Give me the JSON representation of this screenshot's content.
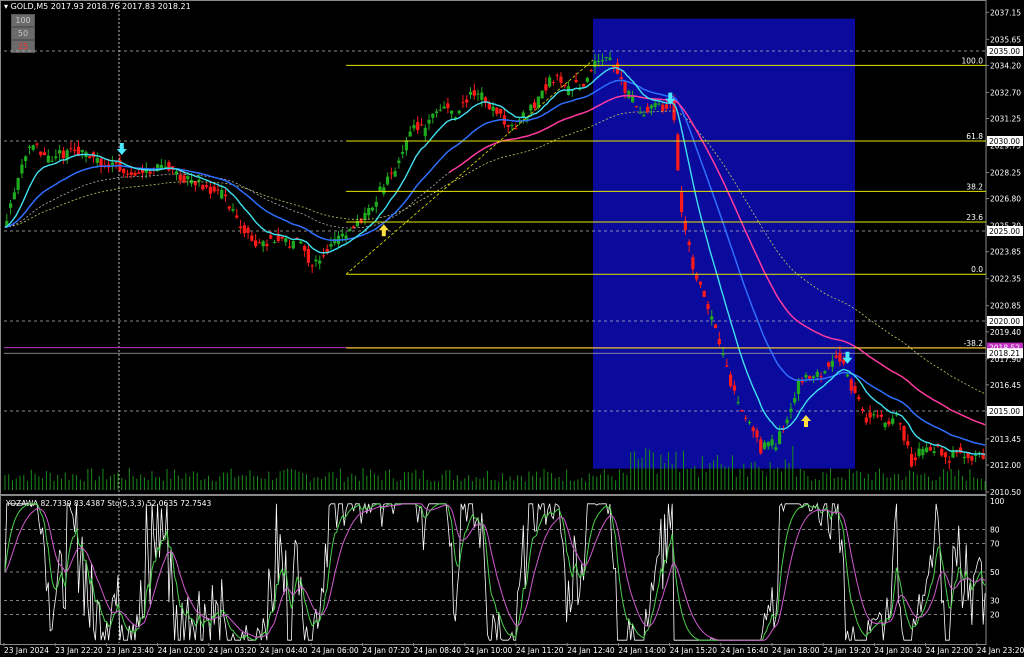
{
  "header": {
    "symbol_line": "GOLD,M5  2017.93 2018.76 2017.83 2018.21"
  },
  "buttons": [
    {
      "label": "100",
      "bg": "#6b6b6b",
      "fg": "#c8c8c8"
    },
    {
      "label": "50",
      "bg": "#6b6b6b",
      "fg": "#c8c8c8"
    },
    {
      "label": "25",
      "bg": "#6b6b6b",
      "fg": "#ff3030"
    }
  ],
  "indicator": {
    "label": "YOZAWA 82.7339 83.4387  Sto(5,3,3) 52.0635 72.7543"
  },
  "colors": {
    "bull": "#1faa1f",
    "bear": "#ff1a1a",
    "cyan_ma": "#40e0f0",
    "blue_ma": "#2f6fff",
    "magenta_ma": "#ff3aa0",
    "fib": "#e6e600",
    "highlight": "#0a0a9c",
    "volume": "#1a8a1a"
  },
  "chart_data": [
    {
      "type": "candlestick",
      "title": "GOLD,M5",
      "ylim": [
        2010.5,
        2037.5
      ],
      "price_ticks": [
        "2037.15",
        "2035.65",
        "2034.20",
        "2032.70",
        "2031.25",
        "2029.75",
        "2028.25",
        "2026.80",
        "2025.30",
        "2023.85",
        "2022.35",
        "2020.85",
        "2019.40",
        "2017.90",
        "2016.45",
        "2014.95",
        "2013.45",
        "2012.00",
        "2010.50"
      ],
      "price_boxes": [
        {
          "label": "2035.00",
          "value": 2035.0
        },
        {
          "label": "2030.00",
          "value": 2030.0
        },
        {
          "label": "2025.00",
          "value": 2025.0
        },
        {
          "label": "2020.00",
          "value": 2020.0
        },
        {
          "label": "2018.52",
          "value": 2018.52
        },
        {
          "label": "2018.21",
          "value": 2018.21
        },
        {
          "label": "2015.00",
          "value": 2015.0
        }
      ],
      "fibonacci": [
        {
          "label": "100.0",
          "price": 2034.2
        },
        {
          "label": "61.8",
          "price": 2030.0
        },
        {
          "label": "38.2",
          "price": 2027.2
        },
        {
          "label": "23.6",
          "price": 2025.5
        },
        {
          "label": "0.0",
          "price": 2022.6
        },
        {
          "label": "-38.2",
          "price": 2018.5
        }
      ],
      "x_labels": [
        "23 Jan 2024",
        "23 Jan 22:20",
        "23 Jan 23:40",
        "24 Jan 02:00",
        "24 Jan 03:20",
        "24 Jan 04:40",
        "24 Jan 06:00",
        "24 Jan 07:20",
        "24 Jan 08:40",
        "24 Jan 10:00",
        "24 Jan 11:20",
        "24 Jan 12:40",
        "24 Jan 14:00",
        "24 Jan 15:20",
        "24 Jan 16:40",
        "24 Jan 18:00",
        "24 Jan 19:20",
        "24 Jan 20:40",
        "24 Jan 22:00",
        "24 Jan 23:20"
      ],
      "close_path": [
        [
          0,
          2025.3
        ],
        [
          4,
          2026.7
        ],
        [
          8,
          2028.4
        ],
        [
          12,
          2029.6
        ],
        [
          17,
          2029.8
        ],
        [
          22,
          2029.1
        ],
        [
          28,
          2029.2
        ],
        [
          34,
          2029.3
        ],
        [
          40,
          2029.5
        ],
        [
          46,
          2029.1
        ],
        [
          52,
          2028.8
        ],
        [
          58,
          2028.8
        ],
        [
          64,
          2028.4
        ],
        [
          70,
          2028.3
        ],
        [
          76,
          2028.2
        ],
        [
          82,
          2028.6
        ],
        [
          88,
          2028.6
        ],
        [
          92,
          2028.0
        ],
        [
          96,
          2027.9
        ],
        [
          100,
          2027.9
        ],
        [
          105,
          2027.6
        ],
        [
          110,
          2027.3
        ],
        [
          115,
          2027.0
        ],
        [
          120,
          2026.2
        ],
        [
          124,
          2025.3
        ],
        [
          128,
          2025.0
        ],
        [
          132,
          2024.4
        ],
        [
          136,
          2024.4
        ],
        [
          141,
          2024.5
        ],
        [
          145,
          2024.6
        ],
        [
          149,
          2024.4
        ],
        [
          153,
          2024.3
        ],
        [
          157,
          2024.7
        ],
        [
          160,
          2023.7
        ],
        [
          163,
          2023.2
        ],
        [
          167,
          2023.5
        ],
        [
          170,
          2024.0
        ],
        [
          174,
          2024.2
        ],
        [
          178,
          2024.6
        ],
        [
          182,
          2025.1
        ],
        [
          186,
          2025.1
        ],
        [
          190,
          2025.8
        ],
        [
          193,
          2026.1
        ],
        [
          196,
          2026.5
        ],
        [
          199,
          2027.2
        ],
        [
          202,
          2027.7
        ],
        [
          206,
          2028.2
        ],
        [
          210,
          2029.1
        ],
        [
          214,
          2030.1
        ],
        [
          218,
          2031.0
        ],
        [
          222,
          2030.5
        ],
        [
          226,
          2031.5
        ],
        [
          230,
          2031.9
        ],
        [
          234,
          2032.1
        ],
        [
          238,
          2031.4
        ],
        [
          242,
          2032.1
        ],
        [
          246,
          2032.5
        ],
        [
          250,
          2032.6
        ],
        [
          254,
          2032.4
        ],
        [
          258,
          2031.9
        ],
        [
          262,
          2031.6
        ],
        [
          266,
          2030.8
        ],
        [
          270,
          2030.6
        ],
        [
          274,
          2031.2
        ],
        [
          278,
          2031.6
        ],
        [
          282,
          2032.1
        ],
        [
          286,
          2032.9
        ],
        [
          290,
          2033.5
        ],
        [
          294,
          2033.4
        ],
        [
          298,
          2032.8
        ],
        [
          302,
          2033.2
        ],
        [
          306,
          2033.1
        ],
        [
          310,
          2033.7
        ],
        [
          314,
          2034.5
        ],
        [
          318,
          2034.8
        ],
        [
          322,
          2034.5
        ],
        [
          326,
          2033.6
        ],
        [
          330,
          2032.6
        ],
        [
          334,
          2032.2
        ],
        [
          338,
          2031.3
        ],
        [
          342,
          2032.0
        ],
        [
          346,
          2031.9
        ],
        [
          350,
          2031.9
        ],
        [
          354,
          2032.0
        ],
        [
          356,
          2030.1
        ],
        [
          358,
          2027.0
        ],
        [
          361,
          2025.0
        ],
        [
          365,
          2023.0
        ],
        [
          368,
          2022.3
        ],
        [
          372,
          2020.8
        ],
        [
          376,
          2019.8
        ],
        [
          380,
          2018.3
        ],
        [
          384,
          2017.0
        ],
        [
          388,
          2015.5
        ],
        [
          391,
          2014.9
        ],
        [
          395,
          2014.4
        ],
        [
          399,
          2013.4
        ],
        [
          402,
          2012.7
        ],
        [
          405,
          2013.5
        ],
        [
          409,
          2013.0
        ],
        [
          413,
          2014.2
        ],
        [
          417,
          2015.1
        ],
        [
          421,
          2016.6
        ],
        [
          425,
          2016.9
        ],
        [
          429,
          2017.0
        ],
        [
          433,
          2017.2
        ],
        [
          437,
          2017.5
        ],
        [
          441,
          2018.1
        ],
        [
          445,
          2017.4
        ],
        [
          449,
          2016.4
        ],
        [
          453,
          2015.4
        ],
        [
          457,
          2014.6
        ],
        [
          461,
          2015.0
        ],
        [
          465,
          2014.4
        ],
        [
          469,
          2014.4
        ],
        [
          473,
          2014.8
        ],
        [
          477,
          2013.6
        ],
        [
          481,
          2012.2
        ],
        [
          485,
          2012.8
        ],
        [
          489,
          2012.7
        ],
        [
          493,
          2013.0
        ],
        [
          497,
          2012.6
        ],
        [
          501,
          2012.3
        ],
        [
          505,
          2012.9
        ],
        [
          509,
          2012.6
        ],
        [
          513,
          2012.2
        ],
        [
          517,
          2012.5
        ],
        [
          521,
          2012.5
        ]
      ],
      "arrows": [
        {
          "direction": "down",
          "bar": 62,
          "price": 2029.5,
          "color": "cyan"
        },
        {
          "direction": "up",
          "bar": 201,
          "price": 2025.1,
          "color": "yellow"
        },
        {
          "direction": "down",
          "bar": 353,
          "price": 2032.3,
          "color": "cyan"
        },
        {
          "direction": "up",
          "bar": 425,
          "price": 2014.5,
          "color": "yellow"
        },
        {
          "direction": "down",
          "bar": 447,
          "price": 2017.9,
          "color": "cyan"
        }
      ]
    },
    {
      "type": "line",
      "title": "YOZAWA",
      "ylim": [
        0,
        100
      ],
      "levels": [
        20,
        30,
        50,
        70,
        80
      ],
      "tick_labels": [
        "100",
        "80",
        "70",
        "50",
        "30",
        "20"
      ]
    }
  ]
}
